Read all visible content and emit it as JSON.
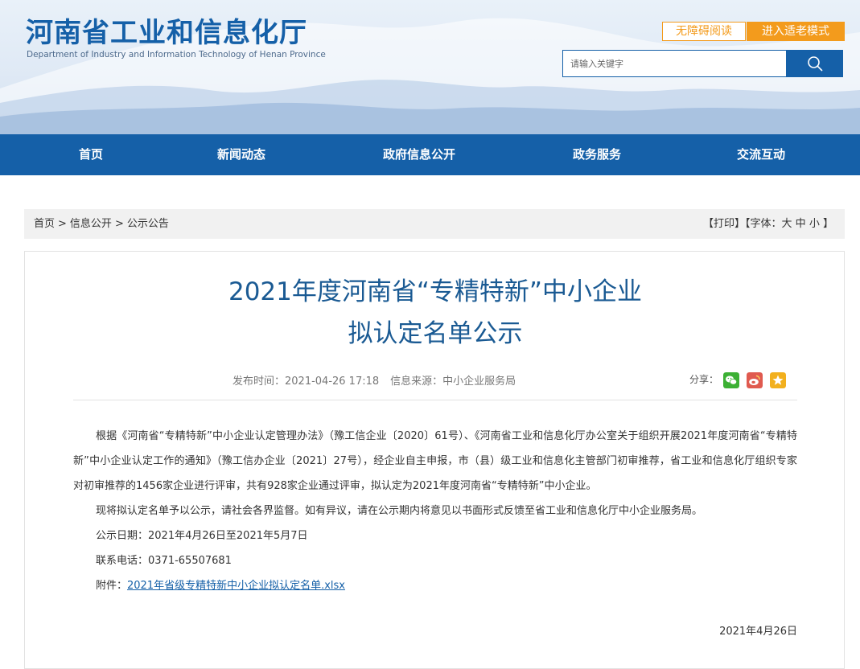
{
  "header": {
    "title": "河南省工业和信息化厅",
    "subtitle": "Department of Industry and Information Technology of Henan Province",
    "accessibility_label": "无障碍阅读",
    "elder_mode_label": "进入适老模式",
    "search_placeholder": "请输入关键字",
    "icon_search": "search-icon"
  },
  "nav": {
    "items": [
      {
        "label": "首页"
      },
      {
        "label": "新闻动态"
      },
      {
        "label": "政府信息公开"
      },
      {
        "label": "政务服务"
      },
      {
        "label": "交流互动"
      }
    ]
  },
  "breadcrumb": {
    "items": [
      "首页",
      "信息公开",
      "公示公告"
    ],
    "separator": ">"
  },
  "tools": {
    "print": "【打印】",
    "font_prefix": "【字体：",
    "large": "大",
    "medium": "中",
    "small": "小",
    "font_suffix": "】"
  },
  "article": {
    "title_line1": "2021年度河南省“专精特新”中小企业",
    "title_line2": "拟认定名单公示",
    "publish_time": "发布时间：2021-04-26 17:18",
    "source": "信息来源：中小企业服务局",
    "share_label": "分享：",
    "share_icons": [
      "wechat-icon",
      "weibo-icon",
      "favorite-star-icon"
    ],
    "paragraph1": "根据《河南省“专精特新”中小企业认定管理办法》（豫工信企业〔2020〕61号）、《河南省工业和信息化厅办公室关于组织开展2021年度河南省“专精特新”中小企业认定工作的通知》（豫工信办企业〔2021〕27号），经企业自主申报，市（县）级工业和信息化主管部门初审推荐，省工业和信息化厅组织专家对初审推荐的1456家企业进行评审，共有928家企业通过评审，拟认定为2021年度河南省“专精特新”中小企业。",
    "paragraph2": "现将拟认定名单予以公示，请社会各界监督。如有异议，请在公示期内将意见以书面形式反馈至省工业和信息化厅中小企业服务局。",
    "notice_period": "公示日期：2021年4月26日至2021年5月7日",
    "phone": "联系电话：0371-65507681",
    "attachment_label": "附件：",
    "attachment_link": "2021年省级专精特新中小企业拟认定名单.xlsx",
    "sign_date": "2021年4月26日"
  },
  "colors": {
    "brand_blue": "#1560a8",
    "accent_orange": "#f39b1c",
    "title_blue": "#1a5a93",
    "wechat_green": "#3cb034",
    "weibo_red": "#e05a4f",
    "star_yellow": "#f2b01e"
  }
}
